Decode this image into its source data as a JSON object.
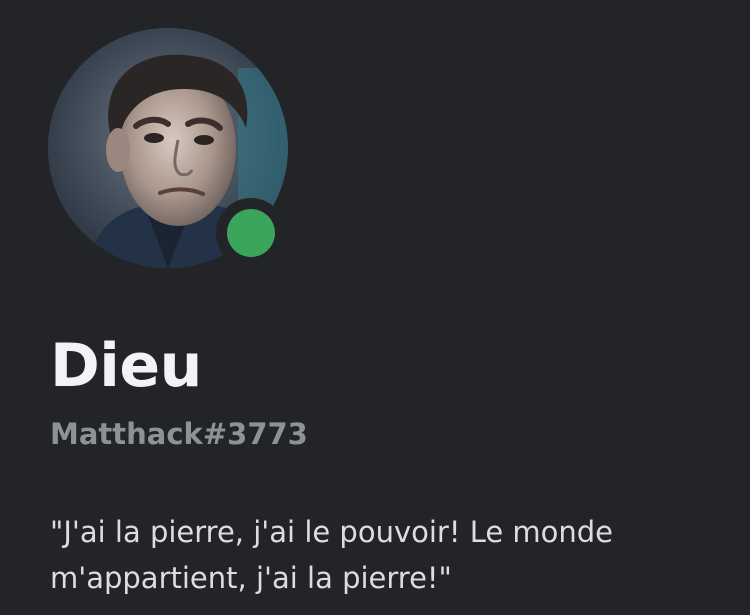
{
  "profile": {
    "display_name": "Dieu",
    "username": "Matthack#3773",
    "bio": "\"J'ai la pierre, j'ai le pouvoir! Le monde m'appartient, j'ai la pierre!\"",
    "status": "online",
    "avatar_icon": "user-avatar-photo"
  },
  "colors": {
    "background": "#232428",
    "status_online": "#3ba55c",
    "display_name": "#f2f3f5",
    "username": "#8e9297",
    "bio": "#dcddde"
  }
}
